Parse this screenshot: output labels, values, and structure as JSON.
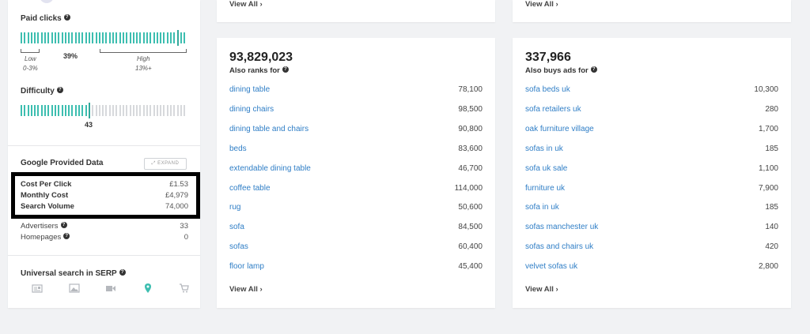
{
  "metrics": {
    "paid_clicks": {
      "label": "Paid clicks",
      "percent": "39%",
      "low_label": "Low",
      "low_range": "0-3%",
      "high_label": "High",
      "high_range": "13%+",
      "marker_fraction": 0.96
    },
    "difficulty": {
      "label": "Difficulty",
      "value": "43",
      "fraction": 0.43
    },
    "google_data": {
      "title": "Google Provided Data",
      "expand_label": "EXPAND",
      "rows": [
        {
          "key": "Cost Per Click",
          "value": "£1.53"
        },
        {
          "key": "Monthly Cost",
          "value": "£4,979"
        },
        {
          "key": "Search Volume",
          "value": "74,000"
        }
      ]
    },
    "advertisers": {
      "label": "Advertisers",
      "value": "33"
    },
    "homepages": {
      "label": "Homepages",
      "value": "0"
    },
    "universal_search": {
      "label": "Universal search in SERP",
      "icons": [
        "news-icon",
        "image-icon",
        "video-icon",
        "map-pin-icon",
        "shopping-cart-icon"
      ],
      "active_icon": "map-pin-icon"
    }
  },
  "top_view_all": [
    "View All",
    "View All"
  ],
  "also_ranks": {
    "total": "93,829,023",
    "title": "Also ranks for",
    "rows": [
      {
        "keyword": "dining table",
        "value": "78,100"
      },
      {
        "keyword": "dining chairs",
        "value": "98,500"
      },
      {
        "keyword": "dining table and chairs",
        "value": "90,800"
      },
      {
        "keyword": "beds",
        "value": "83,600"
      },
      {
        "keyword": "extendable dining table",
        "value": "46,700"
      },
      {
        "keyword": "coffee table",
        "value": "114,000"
      },
      {
        "keyword": "rug",
        "value": "50,600"
      },
      {
        "keyword": "sofa",
        "value": "84,500"
      },
      {
        "keyword": "sofas",
        "value": "60,400"
      },
      {
        "keyword": "floor lamp",
        "value": "45,400"
      }
    ],
    "view_all": "View All"
  },
  "also_buys": {
    "total": "337,966",
    "title": "Also buys ads for",
    "rows": [
      {
        "keyword": "sofa beds uk",
        "value": "10,300"
      },
      {
        "keyword": "sofa retailers uk",
        "value": "280"
      },
      {
        "keyword": "oak furniture village",
        "value": "1,700"
      },
      {
        "keyword": "sofas in uk",
        "value": "185"
      },
      {
        "keyword": "sofa uk sale",
        "value": "1,100"
      },
      {
        "keyword": "furniture uk",
        "value": "7,900"
      },
      {
        "keyword": "sofa in uk",
        "value": "185"
      },
      {
        "keyword": "sofas manchester uk",
        "value": "140"
      },
      {
        "keyword": "sofas and chairs uk",
        "value": "420"
      },
      {
        "keyword": "velvet sofas uk",
        "value": "2,800"
      }
    ],
    "view_all": "View All"
  },
  "colors": {
    "accent": "#3dbeb0",
    "link": "#2f7ec6",
    "inactive": "#d7d9dc"
  }
}
